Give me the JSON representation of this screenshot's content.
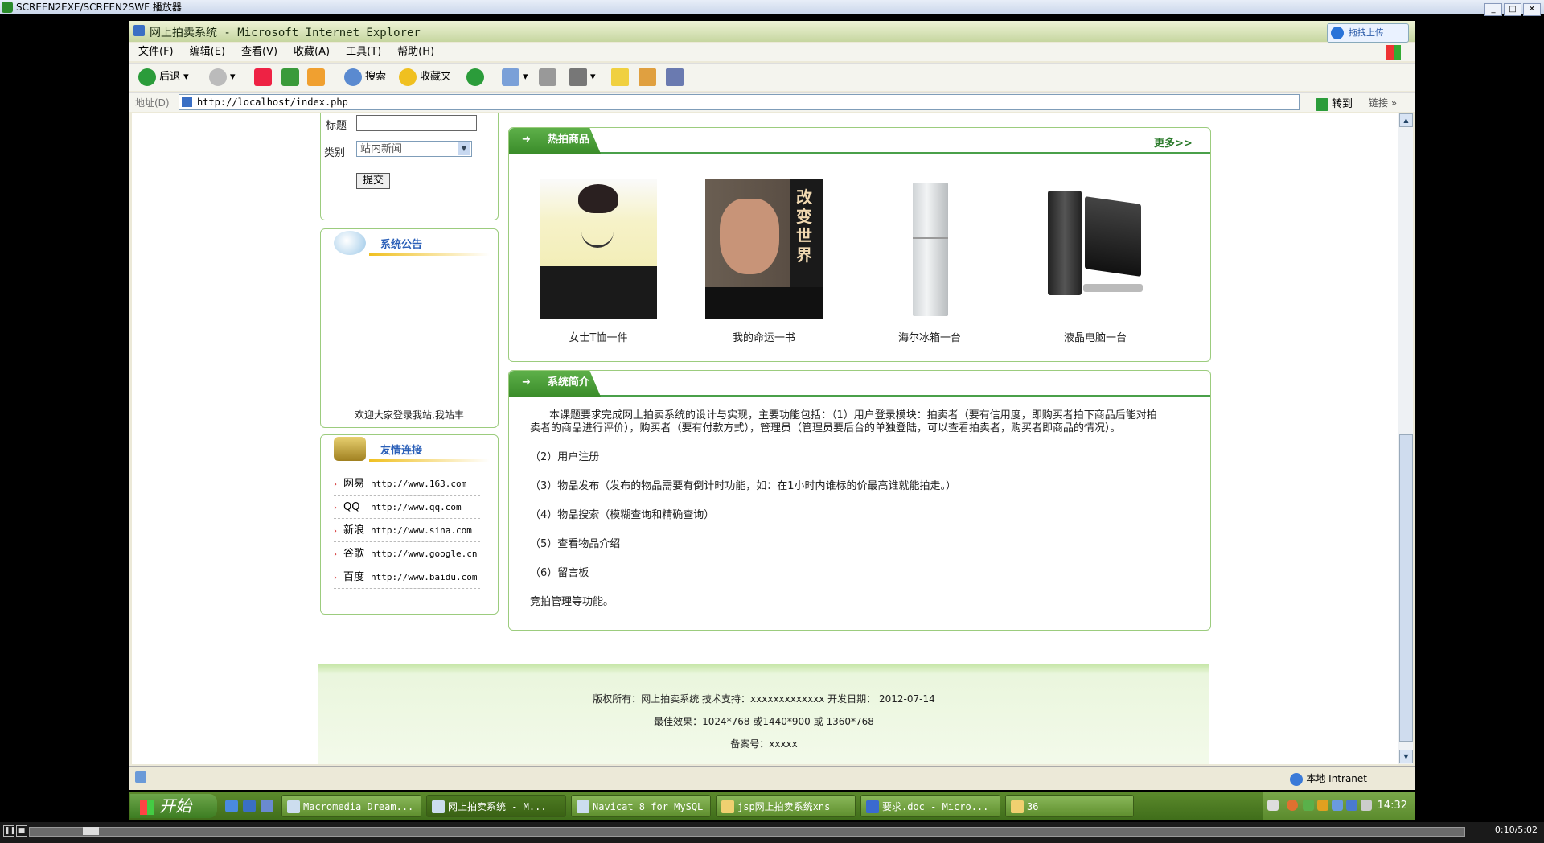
{
  "player": {
    "title": "SCREEN2EXE/SCREEN2SWF 播放器",
    "time": "0:10/5:02"
  },
  "ie": {
    "title": "网上拍卖系统 - Microsoft Internet Explorer",
    "upload_label": "拖拽上传",
    "menu": [
      "文件(F)",
      "编辑(E)",
      "查看(V)",
      "收藏(A)",
      "工具(T)",
      "帮助(H)"
    ],
    "toolbar": {
      "back": "后退",
      "search": "搜索",
      "favorites": "收藏夹"
    },
    "address": {
      "label": "地址(D)",
      "url": "http://localhost/index.php",
      "go": "转到",
      "links": "链接"
    },
    "status": {
      "zone": "本地 Intranet"
    }
  },
  "search_form": {
    "title_label": "标题",
    "title_value": "",
    "category_label": "类别",
    "category_value": "站内新闻",
    "submit": "提交"
  },
  "notice": {
    "heading": "系统公告",
    "marquee": "欢迎大家登录我站,我站丰"
  },
  "friend_links": {
    "heading": "友情连接",
    "items": [
      {
        "name": "网易",
        "url": "http://www.163.com"
      },
      {
        "name": "QQ",
        "url": "http://www.qq.com"
      },
      {
        "name": "新浪",
        "url": "http://www.sina.com"
      },
      {
        "name": "谷歌",
        "url": "http://www.google.cn"
      },
      {
        "name": "百度",
        "url": "http://www.baidu.com"
      }
    ]
  },
  "hot": {
    "heading": "热拍商品",
    "more": "更多>>",
    "products": [
      {
        "name": "女士T恤一件"
      },
      {
        "name": "我的命运一书"
      },
      {
        "name": "海尔冰箱一台"
      },
      {
        "name": "液晶电脑一台"
      }
    ]
  },
  "intro": {
    "heading": "系统简介",
    "p1a": "本课题要求完成网上拍卖系统的设计与实现，主要功能包括：（1）用户登录模块：拍卖者（要有信用度，即购买者拍下商品后能对拍",
    "p1b": "卖者的商品进行评价），购买者（要有付款方式），管理员（管理员要后台的单独登陆，可以查看拍卖者，购买者即商品的情况）。",
    "p2": "（2）用户注册",
    "p3": "（3）物品发布（发布的物品需要有倒计时功能，如：在1小时内谁标的价最高谁就能拍走。）",
    "p4": "（4）物品搜索（模糊查询和精确查询）",
    "p5": "（5）查看物品介绍",
    "p6": "（6）留言板",
    "p7": "竞拍管理等功能。"
  },
  "footer": {
    "line1": "版权所有：网上拍卖系统 技术支持：xxxxxxxxxxxxx 开发日期： 2012-07-14",
    "line2": "最佳效果：1024*768 或1440*900 或 1360*768",
    "line3": "备案号：xxxxx"
  },
  "taskbar": {
    "start": "开始",
    "tasks": [
      "Macromedia Dream...",
      "网上拍卖系统 - M...",
      "Navicat 8 for MySQL",
      "jsp网上拍卖系统xns",
      "要求.doc - Micro...",
      "36"
    ],
    "clock": "14:32"
  }
}
